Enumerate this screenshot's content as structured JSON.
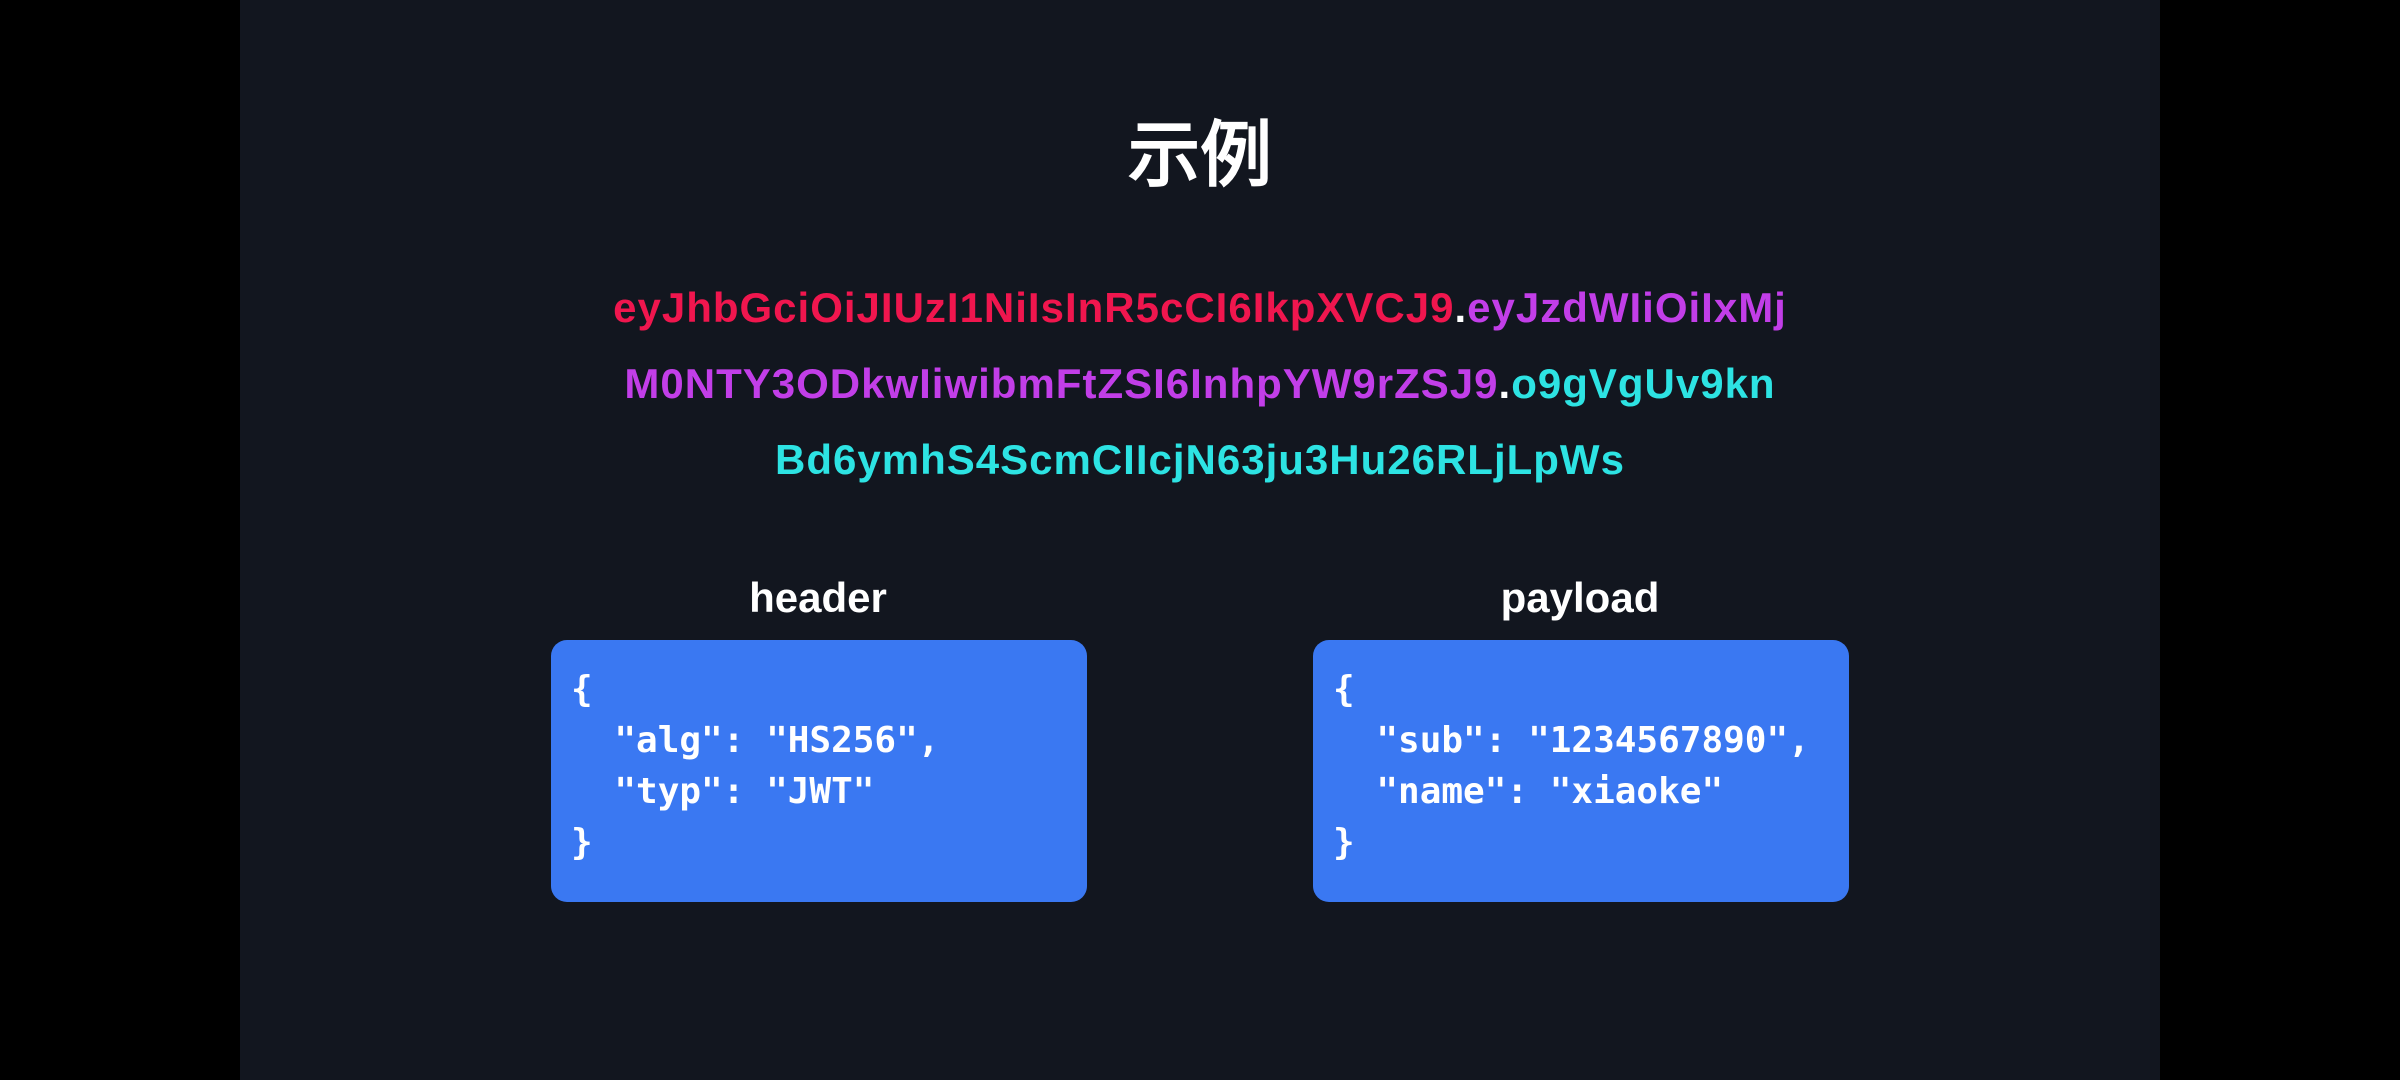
{
  "slide": {
    "title": "示例"
  },
  "token": {
    "line1": {
      "header_part": "eyJhbGciOiJIUzI1NiIsInR5cCI6IkpXVCJ9",
      "dot1": ".",
      "payload_part": "eyJzdWIiOiIxMj"
    },
    "line2": {
      "payload_part": "M0NTY3ODkwIiwibmFtZSI6InhpYW9rZSJ9",
      "dot2": ".",
      "signature_part": "o9gVgUv9kn"
    },
    "line3": {
      "signature_part": "Bd6ymhS4ScmCIIcjN63ju3Hu26RLjLpWs"
    },
    "colors": {
      "header": "#f0164e",
      "payload": "#c23ee8",
      "signature": "#2de3e3"
    }
  },
  "header_box": {
    "label": "header",
    "lines": [
      "{",
      "  \"alg\": \"HS256\",",
      "  \"typ\": \"JWT\"",
      "}"
    ]
  },
  "payload_box": {
    "label": "payload",
    "lines": [
      "{",
      "  \"sub\": \"1234567890\",",
      "  \"name\": \"xiaoke\"",
      "}"
    ]
  },
  "colors": {
    "background": "#12161f",
    "box": "#3a78f2"
  }
}
